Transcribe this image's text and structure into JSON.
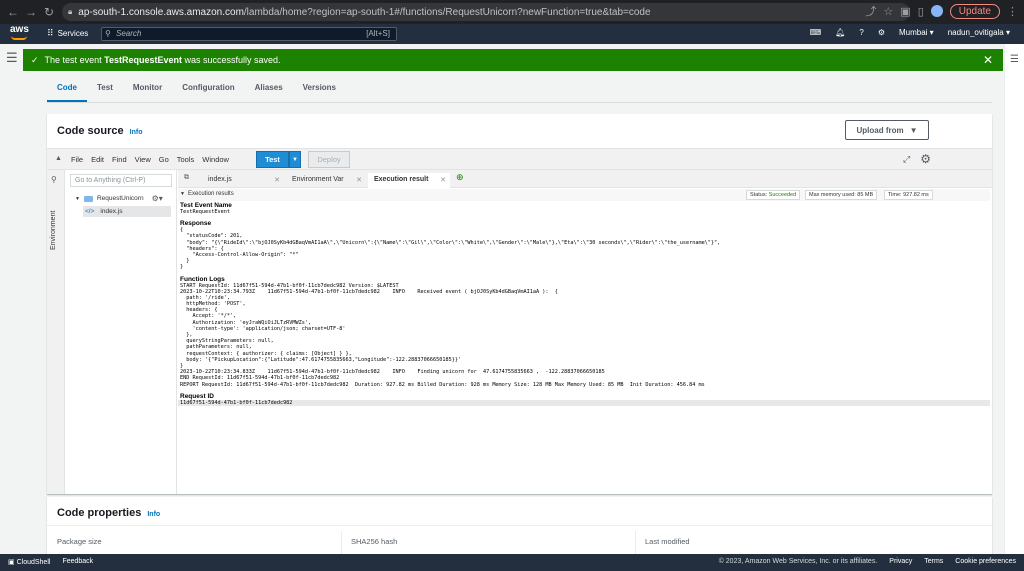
{
  "browser": {
    "url_host": "ap-south-1.console.aws.amazon.com",
    "url_path": "/lambda/home?region=ap-south-1#/functions/RequestUnicorn?newFunction=true&tab=code",
    "update_label": "Update"
  },
  "aws_nav": {
    "logo": "aws",
    "services_label": "Services",
    "search_placeholder": "Search",
    "search_shortcut": "[Alt+S]",
    "region": "Mumbai",
    "user": "nadun_ovitigala"
  },
  "flash": {
    "prefix": "The test event ",
    "event_name": "TestRequestEvent",
    "suffix": " was successfully saved."
  },
  "tabs": [
    "Code",
    "Test",
    "Monitor",
    "Configuration",
    "Aliases",
    "Versions"
  ],
  "code_source": {
    "title": "Code source",
    "info": "Info",
    "upload_label": "Upload from"
  },
  "ide": {
    "menu": [
      "File",
      "Edit",
      "Find",
      "View",
      "Go",
      "Tools",
      "Window"
    ],
    "test_label": "Test",
    "deploy_label": "Deploy",
    "goto_placeholder": "Go to Anything (Ctrl-P)",
    "environment_label": "Environment",
    "folder_name": "RequestUnicorn",
    "file_name": "index.js",
    "editor_tabs": [
      "index.js",
      "Environment Var",
      "Execution result"
    ],
    "results_header": "Execution results",
    "status_label": "Status: ",
    "status_value": "Succeeded",
    "max_memory": "Max memory used: 85 MB",
    "time": "Time: 927.82 ms"
  },
  "output": {
    "test_event_header": "Test Event Name",
    "test_event_value": "TestRequestEvent",
    "response_header": "Response",
    "response_lines": [
      "{",
      "  \"statusCode\": 201,",
      "  \"body\": \"{\\\"RideId\\\":\\\"bjOJ0SyKb4dGBaqVmAI1aA\\\",\\\"Unicorn\\\":{\\\"Name\\\":\\\"Gil\\\",\\\"Color\\\":\\\"White\\\",\\\"Gender\\\":\\\"Male\\\"},\\\"Eta\\\":\\\"30 seconds\\\",\\\"Rider\\\":\\\"the_username\\\"}\",",
      "  \"headers\": {",
      "    \"Access-Control-Allow-Origin\": \"*\"",
      "  }",
      "}"
    ],
    "logs_header": "Function Logs",
    "log_lines": [
      "START RequestId: 11d67f51-594d-47b1-bf0f-11cb7dedc982 Version: $LATEST",
      "2023-10-22T10:23:34.793Z    11d67f51-594d-47b1-bf0f-11cb7dedc982    INFO    Received event ( bjOJ0SyKb4dGBaqVmAI1aA ):  {",
      "  path: '/ride',",
      "  httpMethod: 'POST',",
      "  headers: {",
      "    Accept: '*/*',",
      "    Authorization: 'eyJraWQiOiJLTzRVMWZs',",
      "    'content-type': 'application/json; charset=UTF-8'",
      "  },",
      "  queryStringParameters: null,",
      "  pathParameters: null,",
      "  requestContext: { authorizer: { claims: [Object] } },",
      "  body: '{\"PickupLocation\":{\"Latitude\":47.6174755835663,\"Longitude\":-122.28837066650185}}'",
      "}",
      "2023-10-22T10:23:34.833Z    11d67f51-594d-47b1-bf0f-11cb7dedc982    INFO    Finding unicorn for  47.6174755835663 ,  -122.28837066650185",
      "END RequestId: 11d67f51-594d-47b1-bf0f-11cb7dedc982",
      "REPORT RequestId: 11d67f51-594d-47b1-bf0f-11cb7dedc982  Duration: 927.82 ms Billed Duration: 928 ms Memory Size: 128 MB Max Memory Used: 85 MB  Init Duration: 456.84 ms"
    ],
    "request_id_header": "Request ID",
    "request_id_value": "11d67f51-594d-47b1-bf0f-11cb7dedc982"
  },
  "code_properties": {
    "title": "Code properties",
    "info": "Info",
    "col1": "Package size",
    "col2": "SHA256 hash",
    "col3": "Last modified"
  },
  "footer": {
    "cloudshell": "CloudShell",
    "feedback": "Feedback",
    "copyright": "© 2023, Amazon Web Services, Inc. or its affiliates.",
    "privacy": "Privacy",
    "terms": "Terms",
    "cookies": "Cookie preferences"
  }
}
